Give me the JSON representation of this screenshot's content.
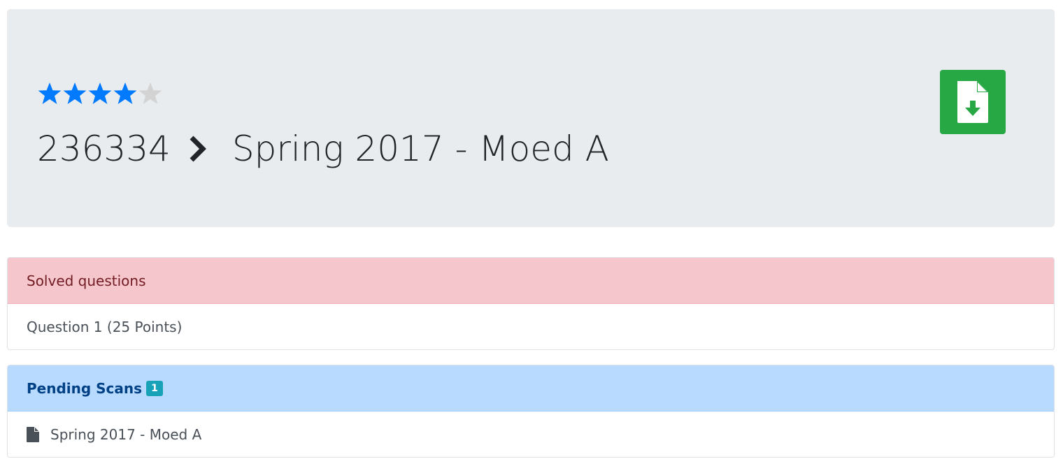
{
  "header": {
    "rating": {
      "value": 4,
      "max": 5,
      "filled_color": "#007bff",
      "empty_color": "#d3d3d3"
    },
    "course_number": "236334",
    "exam_title": "Spring 2017 - Moed A",
    "download_button_icon": "file-download-icon",
    "download_button_color": "#28a745"
  },
  "solved": {
    "title": "Solved questions",
    "items": [
      {
        "label": "Question 1 (25 Points)"
      }
    ]
  },
  "pending": {
    "title": "Pending Scans",
    "count": "1",
    "items": [
      {
        "icon": "file-icon",
        "label": "Spring 2017 - Moed A"
      }
    ]
  }
}
